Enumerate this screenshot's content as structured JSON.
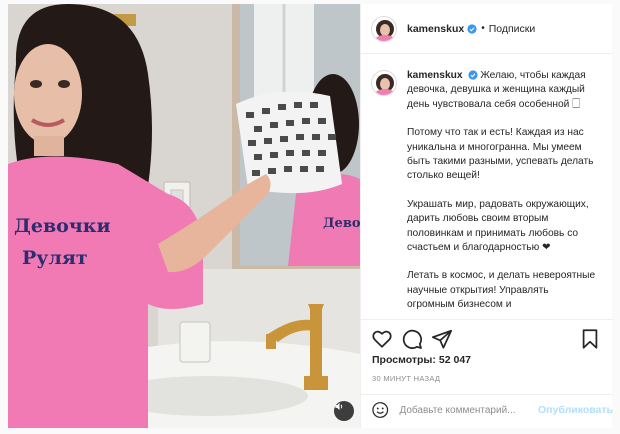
{
  "post": {
    "username": "kamenskux",
    "dot": "•",
    "follow_label": "Подписки",
    "caption": [
      "Желаю, чтобы каждая девочка, девушка и женщина каждый день чувствовала себя особенной 🗌",
      "Потому что так и есть! Каждая из нас уникальна и многогранна. Мы умеем быть такими разными, успевать делать столько вещей!",
      "Украшать мир, радовать окружающих, дарить любовь своим вторым половинкам и принимать любовь со счастьем и благодарностью ❤",
      "Летать в космос, и делать невероятные научные открытия! Управлять огромным бизнесом и"
    ],
    "views_label": "Просмотры:",
    "views_count": "52 047",
    "time": "30 минут назад",
    "comment_placeholder": "Добавьте комментарий...",
    "publish_label": "Опубликовать"
  },
  "media": {
    "shirt_text_line1": "Девочки",
    "shirt_text_line2": "Рулят",
    "mirror_shirt_text": "Девочки"
  },
  "icons": {
    "verified": "verified-badge-icon",
    "like": "heart-icon",
    "comment": "comment-icon",
    "share": "share-icon",
    "save": "bookmark-icon",
    "sound": "speaker-icon",
    "emoji": "emoji-icon"
  },
  "colors": {
    "verified_blue": "#3897f0",
    "shirt_pink": "#f17ab5",
    "publish_disabled": "#b2dffc",
    "muted_text": "#8e8e8e"
  }
}
